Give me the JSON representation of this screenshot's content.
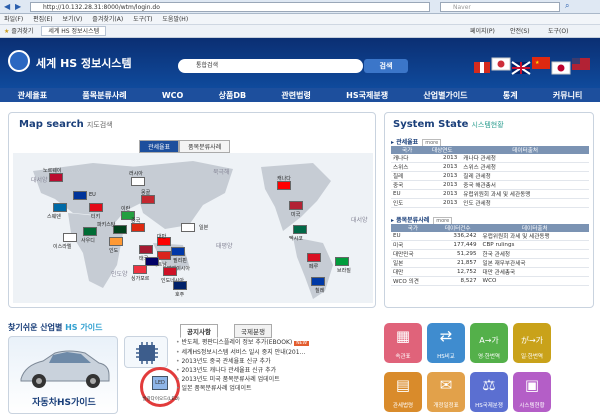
{
  "browser": {
    "url": "http://10.132.28.31:8000/wtm/login.do",
    "search_placeholder": "Naver",
    "menu": [
      "파일(F)",
      "편집(E)",
      "보기(V)",
      "즐겨찾기(A)",
      "도구(T)",
      "도움말(H)"
    ],
    "favorites_label": "즐겨찾기",
    "tab_title": "세계 HS 정보시스템",
    "tools": [
      "페이지(P)",
      "안전(S)",
      "도구(O)"
    ]
  },
  "header": {
    "site_title": "세계 HS 정보시스템",
    "search_scope": "통합검색",
    "search_button": "검색"
  },
  "nav": [
    "관세율표",
    "품목분류사례",
    "WCO",
    "상품DB",
    "관련법령",
    "HS국제분쟁",
    "산업별가이드",
    "통계",
    "커뮤니티"
  ],
  "map": {
    "title": "Map search",
    "subtitle": "지도검색",
    "tabs": [
      "관세율표",
      "품목분류사례"
    ],
    "oceans": [
      "대서양",
      "북극해",
      "태평양",
      "인도양",
      "대서양"
    ],
    "countries": [
      "노르웨이",
      "EU",
      "러시아",
      "스웨덴",
      "터키",
      "이란",
      "몽골",
      "중국",
      "일본",
      "사우디",
      "이스라엘",
      "인도",
      "파키스탄",
      "대만",
      "필리핀",
      "태국",
      "베트남",
      "말레이시아",
      "싱가포르",
      "인도네시아",
      "호주",
      "캐나다",
      "미국",
      "멕시코",
      "페루",
      "브라질",
      "칠레"
    ]
  },
  "system_state": {
    "title": "System State",
    "subtitle": "시스템현황",
    "tariff": {
      "title": "관세율표",
      "more": "more",
      "headers": [
        "국가",
        "대상연도",
        "데이터출처"
      ],
      "rows": [
        [
          "캐나다",
          "2013",
          "캐나다 관세청"
        ],
        [
          "스위스",
          "2013",
          "스위스 관세청"
        ],
        [
          "칠레",
          "2013",
          "칠레 관세청"
        ],
        [
          "중국",
          "2013",
          "중국 해관총서"
        ],
        [
          "EU",
          "2013",
          "유럽위원회 과세 및 세관동맹"
        ],
        [
          "인도",
          "2013",
          "인도 관세청"
        ]
      ]
    },
    "classification": {
      "title": "품목분류사례",
      "more": "more",
      "headers": [
        "국가",
        "데이터건수",
        "데이터출처"
      ],
      "rows": [
        [
          "EU",
          "336,242",
          "유럽위원회 과세 및 세관동맹"
        ],
        [
          "미국",
          "177,449",
          "CBP rulings"
        ],
        [
          "대만민국",
          "51,295",
          "한국 관세청"
        ],
        [
          "일본",
          "21,857",
          "일본 재무부관세국"
        ],
        [
          "대만",
          "12,752",
          "대만 관세총국"
        ],
        [
          "WCO 의견",
          "8,527",
          "WCO"
        ]
      ]
    }
  },
  "guide": {
    "title_prefix": "찾기쉬운 산업별",
    "title_suffix": "HS 가이드",
    "car_label": "자동차HS가이드",
    "led_label": "LED",
    "led_caption": "발광다이오드(LED)"
  },
  "notices": {
    "tabs": [
      "공지사항",
      "국제분쟁"
    ],
    "items": [
      "반도체, 평판디스플레이 정보 추가(EBOOK)",
      "세계HS정보시스템 서비스 일시 중지 안내(201...",
      "2013년도 중국 관세율표 신규 추가",
      "2013년도 캐나다 관세율표 신규 추가",
      "2013년도 미국 품목분류사례 업데이트",
      "일본 품목분류사례 업데이트"
    ],
    "new_badge": "NEW"
  },
  "tiles": [
    {
      "label": "속관표",
      "icon": "table-icon",
      "glyph": "▦",
      "color": "#e0637a"
    },
    {
      "label": "HS비교",
      "icon": "compare-icon",
      "glyph": "⇄",
      "color": "#3f8ccf"
    },
    {
      "label": "영·한번역",
      "icon": "translate-icon",
      "glyph": "A→가",
      "color": "#54b04a"
    },
    {
      "label": "일·한번역",
      "icon": "translate-ja-icon",
      "glyph": "が→가",
      "color": "#c9a21a"
    },
    {
      "label": "",
      "icon": "blank-icon",
      "glyph": "",
      "color": "#ffffff"
    },
    {
      "label": "관세법령",
      "icon": "law-icon",
      "glyph": "▤",
      "color": "#d98b2b"
    },
    {
      "label": "개정일정표",
      "icon": "calendar-icon",
      "glyph": "✉",
      "color": "#e2a14a"
    },
    {
      "label": "HS국제분쟁",
      "icon": "dispute-icon",
      "glyph": "⚖",
      "color": "#5b6fd1"
    },
    {
      "label": "시스템현황",
      "icon": "monitor-icon",
      "glyph": "▣",
      "color": "#b45ec7"
    }
  ]
}
